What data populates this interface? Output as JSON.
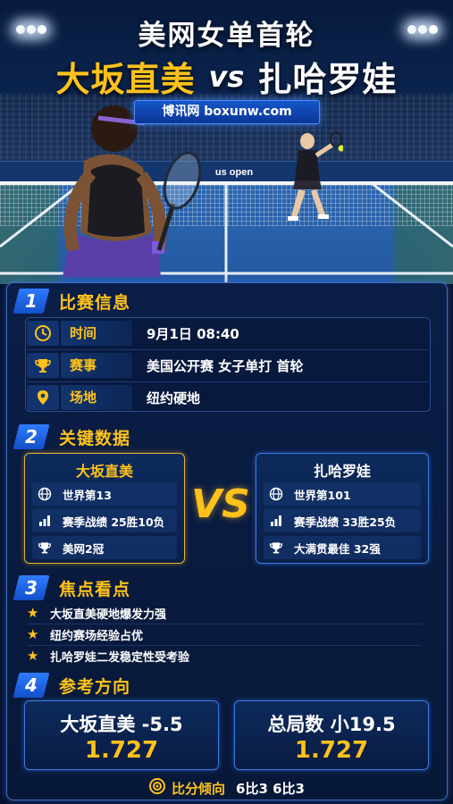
{
  "header": {
    "title": "美网女单首轮",
    "player1": "大坂直美",
    "vs": "vs",
    "player2": "扎哈罗娃",
    "source": "博讯网 boxunw.com",
    "banner_logo": "us open"
  },
  "section1": {
    "number": "1",
    "title": "比赛信息",
    "rows": [
      {
        "icon": "clock-icon",
        "label": "时间",
        "value": "9月1日 08:40"
      },
      {
        "icon": "trophy-icon",
        "label": "赛事",
        "value": "美国公开赛 女子单打 首轮"
      },
      {
        "icon": "location-pin-icon",
        "label": "场地",
        "value": "纽约硬地"
      }
    ]
  },
  "section2": {
    "number": "2",
    "title": "关键数据",
    "vs_label": "VS",
    "player1": {
      "name": "大坂直美",
      "rows": [
        {
          "icon": "globe-icon",
          "text": "世界第13"
        },
        {
          "icon": "bar-chart-icon",
          "text": "赛季战绩 25胜10负"
        },
        {
          "icon": "trophy-icon",
          "text": "美网2冠"
        }
      ]
    },
    "player2": {
      "name": "扎哈罗娃",
      "rows": [
        {
          "icon": "globe-icon",
          "text": "世界第101"
        },
        {
          "icon": "bar-chart-icon",
          "text": "赛季战绩 33胜25负"
        },
        {
          "icon": "trophy-icon",
          "text": "大满贯最佳 32强"
        }
      ]
    }
  },
  "section3": {
    "number": "3",
    "title": "焦点看点",
    "items": [
      "大坂直美硬地爆发力强",
      "纽约赛场经验占优",
      "扎哈罗娃二发稳定性受考验"
    ]
  },
  "section4": {
    "number": "4",
    "title": "参考方向",
    "bet1": {
      "title": "大坂直美 -5.5",
      "odds": "1.727"
    },
    "bet2": {
      "title": "总局数 小19.5",
      "odds": "1.727"
    },
    "tendency_label": "比分倾向",
    "tendency_value": "6比3 6比3"
  },
  "colors": {
    "accent_gold": "#ffc21a",
    "accent_blue": "#2f7bff",
    "background": "#06122e"
  }
}
